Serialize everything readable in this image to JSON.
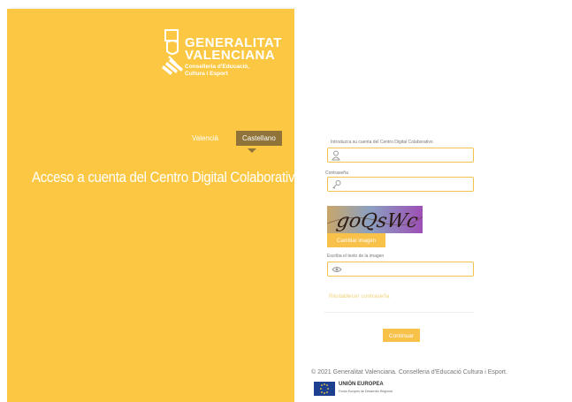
{
  "brand": {
    "name": "GENERALITAT\nVALENCIANA",
    "department": "Conselleria d'Educació,\nCultura i Esport"
  },
  "language": {
    "valencian": "Valencià",
    "castilian": "Castellano",
    "selected": "Castellano"
  },
  "headline": "Acceso a cuenta del Centro Digital Colaborativo",
  "form": {
    "username_label": "Introduzca su cuenta del Centro Digital Colaborativo",
    "username_value": "",
    "password_label": "Contraseña",
    "password_value": "",
    "captcha_text": "goQsWc",
    "change_image_label": "Cambiar imagen",
    "captcha_label": "Escriba el texto de la imagen",
    "captcha_value": "",
    "reset_password_link": "Restablecer contraseña",
    "submit_label": "Continuar"
  },
  "footer": {
    "copyright": "© 2021 Generalitat Valenciana. Conselleria d'Educació Cultura i Esport.",
    "eu_title": "UNIÓN EUROPEA",
    "eu_subtitle": "Fondo Europeo de Desarrollo Regional"
  },
  "colors": {
    "accent": "#fcc844",
    "selected_lang_bg": "#8f7339",
    "input_border": "#f2c24a"
  },
  "icons": {
    "username": "user-icon",
    "password": "key-icon",
    "captcha": "eye-icon"
  }
}
